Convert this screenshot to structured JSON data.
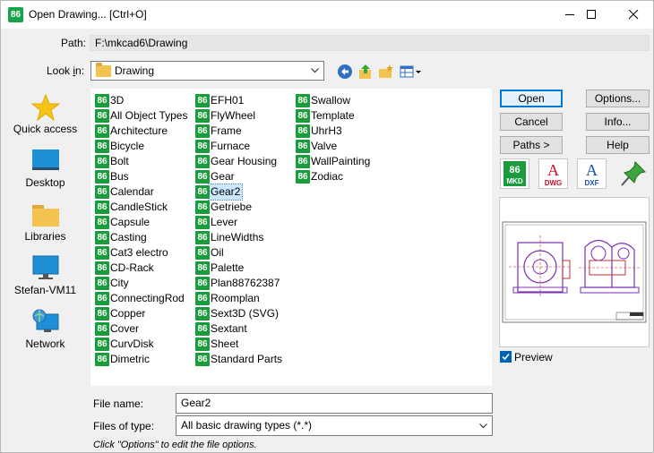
{
  "window": {
    "title": "Open Drawing... [Ctrl+O]",
    "app_icon_text": "86",
    "controls": [
      "minimize",
      "maximize",
      "close"
    ]
  },
  "path": {
    "label": "Path:",
    "value": "F:\\mkcad6\\Drawing"
  },
  "lookin": {
    "label": "Look in:",
    "value": "Drawing"
  },
  "places": [
    {
      "label": "Quick access",
      "icon": "star-icon"
    },
    {
      "label": "Desktop",
      "icon": "desktop-icon"
    },
    {
      "label": "Libraries",
      "icon": "libraries-icon"
    },
    {
      "label": "Stefan-VM11",
      "icon": "computer-icon"
    },
    {
      "label": "Network",
      "icon": "network-icon"
    }
  ],
  "files": {
    "icon_text": "86",
    "col1": [
      "3D",
      "All Object Types",
      "Architecture",
      "Bicycle",
      "Bolt",
      "Bus",
      "Calendar",
      "CandleStick",
      "Capsule",
      "Casting",
      "Cat3 electro",
      "CD-Rack",
      "City",
      "ConnectingRod",
      "Copper",
      "Cover",
      "CurvDisk",
      "Dimetric"
    ],
    "col2": [
      "EFH01",
      "FlyWheel",
      "Frame",
      "Furnace",
      "Gear Housing",
      "Gear",
      "Gear2",
      "Getriebe",
      "Lever",
      "LineWidths",
      "Oil",
      "Palette",
      "Plan88762387",
      "Roomplan",
      "Sext3D (SVG)",
      "Sextant",
      "Sheet",
      "Standard Parts"
    ],
    "col3": [
      "Swallow",
      "Template",
      "UhrH3",
      "Valve",
      "WallPainting",
      "Zodiac"
    ],
    "selected": "Gear2"
  },
  "buttons": {
    "open": "Open",
    "cancel": "Cancel",
    "paths": "Paths >",
    "options": "Options...",
    "info": "Info...",
    "help": "Help"
  },
  "formats": [
    {
      "label": "MKD",
      "icon": "mkd-format-icon"
    },
    {
      "label": "DWG",
      "icon": "dwg-format-icon"
    },
    {
      "label": "DXF",
      "icon": "dxf-format-icon"
    },
    {
      "label": "",
      "icon": "pin-icon"
    }
  ],
  "preview": {
    "label": "Preview",
    "checked": true
  },
  "filename": {
    "label": "File name:",
    "value": "Gear2"
  },
  "filetype": {
    "label": "Files of type:",
    "value": "All basic drawing types (*.*)"
  },
  "hint": "Click \"Options\" to edit the file options.",
  "colors": {
    "accent": "#0078d7",
    "app_green": "#1a9b3c",
    "selection": "#cce8ff"
  }
}
